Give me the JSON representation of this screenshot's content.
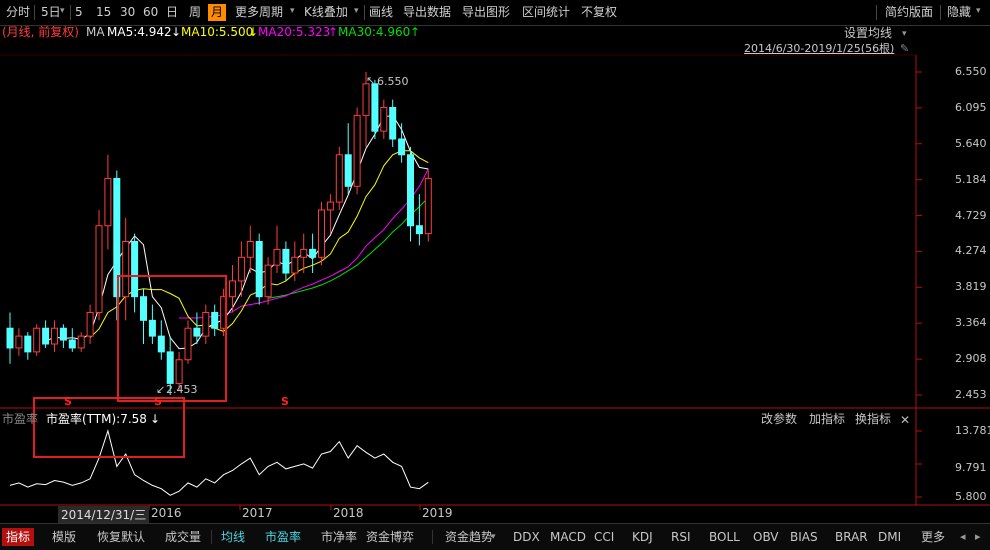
{
  "toolbar": {
    "items": [
      "分时",
      "5日",
      "5",
      "15",
      "30",
      "60",
      "日",
      "周",
      "月",
      "更多周期",
      "K线叠加",
      "画线",
      "导出数据",
      "导出图形",
      "区间统计",
      "不复权"
    ],
    "active": "月",
    "right": [
      "简约版面",
      "隐藏"
    ]
  },
  "legend": {
    "period": "(月线, 前复权)",
    "ma_label": "MA",
    "ma5": "MA5:4.942",
    "ma10": "MA10:5.500",
    "ma20": "MA20:5.323",
    "ma30": "MA30:4.960",
    "arrow_down": "↓",
    "arrow_up": "↑",
    "settings": "设置均线",
    "range": "2014/6/30-2019/1/25(56根)"
  },
  "colors": {
    "up": "#ff3c3c",
    "down": "#54ffff",
    "ma5": "#ffffff",
    "ma10": "#ffff00",
    "ma20": "#ff00ff",
    "ma30": "#00e000",
    "grid": "#3a0000",
    "axis": "#b01010",
    "highlight": "#e02020",
    "active_tab": "#b51010",
    "active_toolbar": "#ff8c00"
  },
  "price_axis": [
    "6.550",
    "6.095",
    "5.640",
    "5.184",
    "4.729",
    "4.274",
    "3.819",
    "3.364",
    "2.908",
    "2.453"
  ],
  "annotations": {
    "high": "6.550",
    "low": "2.453",
    "s_marker": "S"
  },
  "indicator": {
    "name": "市盈率",
    "title": "市盈率(TTM):7.58",
    "arrow": "↓",
    "buttons": [
      "改参数",
      "加指标",
      "换指标"
    ],
    "axis": [
      "13.781",
      "9.791",
      "5.800"
    ]
  },
  "x_axis": {
    "cursor_date": "2014/12/31/三",
    "years": [
      "2016",
      "2017",
      "2018",
      "2019"
    ]
  },
  "tabs": [
    "指标",
    "模版",
    "恢复默认",
    "成交量",
    "均线",
    "市盈率",
    "市净率",
    "资金博弈",
    "资金趋势",
    "DDX",
    "MACD",
    "CCI",
    "KDJ",
    "RSI",
    "BOLL",
    "OBV",
    "BIAS",
    "BRAR",
    "DMI",
    "更多"
  ],
  "active_tab": "指标",
  "cyan_tabs": [
    "均线",
    "市盈率"
  ],
  "chart_data": {
    "type": "candlestick",
    "price_range": [
      2.453,
      6.55
    ],
    "candles": [
      {
        "o": 3.3,
        "h": 3.5,
        "l": 2.85,
        "c": 3.05
      },
      {
        "o": 3.05,
        "h": 3.3,
        "l": 2.95,
        "c": 3.2
      },
      {
        "o": 3.2,
        "h": 3.25,
        "l": 2.9,
        "c": 3.0
      },
      {
        "o": 3.0,
        "h": 3.35,
        "l": 2.95,
        "c": 3.3
      },
      {
        "o": 3.3,
        "h": 3.4,
        "l": 3.05,
        "c": 3.1
      },
      {
        "o": 3.1,
        "h": 3.4,
        "l": 3.0,
        "c": 3.3
      },
      {
        "o": 3.3,
        "h": 3.35,
        "l": 3.05,
        "c": 3.15
      },
      {
        "o": 3.15,
        "h": 3.3,
        "l": 3.0,
        "c": 3.05
      },
      {
        "o": 3.05,
        "h": 3.25,
        "l": 3.0,
        "c": 3.2
      },
      {
        "o": 3.2,
        "h": 3.6,
        "l": 3.1,
        "c": 3.5
      },
      {
        "o": 3.5,
        "h": 4.8,
        "l": 3.4,
        "c": 4.6
      },
      {
        "o": 4.6,
        "h": 5.5,
        "l": 4.3,
        "c": 5.2
      },
      {
        "o": 5.2,
        "h": 5.3,
        "l": 3.4,
        "c": 3.7
      },
      {
        "o": 3.7,
        "h": 4.7,
        "l": 3.4,
        "c": 4.4
      },
      {
        "o": 4.4,
        "h": 4.5,
        "l": 3.5,
        "c": 3.7
      },
      {
        "o": 3.7,
        "h": 3.8,
        "l": 3.1,
        "c": 3.4
      },
      {
        "o": 3.4,
        "h": 3.6,
        "l": 3.1,
        "c": 3.2
      },
      {
        "o": 3.2,
        "h": 3.4,
        "l": 2.9,
        "c": 3.0
      },
      {
        "o": 3.0,
        "h": 3.2,
        "l": 2.453,
        "c": 2.6
      },
      {
        "o": 2.6,
        "h": 3.0,
        "l": 2.5,
        "c": 2.9
      },
      {
        "o": 2.9,
        "h": 3.4,
        "l": 2.85,
        "c": 3.3
      },
      {
        "o": 3.3,
        "h": 3.5,
        "l": 3.1,
        "c": 3.2
      },
      {
        "o": 3.2,
        "h": 3.6,
        "l": 3.1,
        "c": 3.5
      },
      {
        "o": 3.5,
        "h": 3.6,
        "l": 3.2,
        "c": 3.3
      },
      {
        "o": 3.3,
        "h": 3.8,
        "l": 3.2,
        "c": 3.7
      },
      {
        "o": 3.7,
        "h": 4.1,
        "l": 3.5,
        "c": 3.9
      },
      {
        "o": 3.9,
        "h": 4.4,
        "l": 3.7,
        "c": 4.2
      },
      {
        "o": 4.2,
        "h": 4.6,
        "l": 4.0,
        "c": 4.4
      },
      {
        "o": 4.4,
        "h": 4.5,
        "l": 3.6,
        "c": 3.7
      },
      {
        "o": 3.7,
        "h": 4.2,
        "l": 3.6,
        "c": 4.1
      },
      {
        "o": 4.1,
        "h": 4.6,
        "l": 4.0,
        "c": 4.3
      },
      {
        "o": 4.3,
        "h": 4.4,
        "l": 3.9,
        "c": 4.0
      },
      {
        "o": 4.0,
        "h": 4.4,
        "l": 3.9,
        "c": 4.2
      },
      {
        "o": 4.2,
        "h": 4.5,
        "l": 4.0,
        "c": 4.3
      },
      {
        "o": 4.3,
        "h": 4.5,
        "l": 4.0,
        "c": 4.2
      },
      {
        "o": 4.2,
        "h": 4.9,
        "l": 4.1,
        "c": 4.8
      },
      {
        "o": 4.8,
        "h": 5.0,
        "l": 4.5,
        "c": 4.9
      },
      {
        "o": 4.9,
        "h": 5.6,
        "l": 4.8,
        "c": 5.5
      },
      {
        "o": 5.5,
        "h": 5.9,
        "l": 5.0,
        "c": 5.1
      },
      {
        "o": 5.1,
        "h": 6.1,
        "l": 5.0,
        "c": 6.0
      },
      {
        "o": 6.0,
        "h": 6.55,
        "l": 5.6,
        "c": 6.4
      },
      {
        "o": 6.4,
        "h": 6.45,
        "l": 5.7,
        "c": 5.8
      },
      {
        "o": 5.8,
        "h": 6.2,
        "l": 5.7,
        "c": 6.1
      },
      {
        "o": 6.1,
        "h": 6.2,
        "l": 5.6,
        "c": 5.7
      },
      {
        "o": 5.7,
        "h": 5.9,
        "l": 5.4,
        "c": 5.5
      },
      {
        "o": 5.5,
        "h": 5.6,
        "l": 4.4,
        "c": 4.6
      },
      {
        "o": 4.6,
        "h": 5.0,
        "l": 4.35,
        "c": 4.5
      },
      {
        "o": 4.5,
        "h": 5.3,
        "l": 4.4,
        "c": 5.2
      }
    ],
    "ma5": [
      null,
      null,
      null,
      null,
      3.13,
      3.19,
      3.17,
      3.18,
      3.16,
      3.23,
      3.56,
      3.98,
      4.15,
      4.32,
      4.47,
      4.36,
      3.7,
      3.56,
      3.18,
      3.04,
      3.05,
      3.12,
      3.3,
      3.36,
      3.41,
      3.56,
      3.76,
      4.06,
      4.0,
      4.03,
      4.15,
      4.1,
      4.16,
      4.26,
      4.18,
      4.34,
      4.48,
      4.74,
      4.99,
      5.28,
      5.58,
      5.76,
      5.98,
      6.0,
      5.82,
      5.54,
      5.34,
      5.32
    ],
    "ma10": [
      null,
      null,
      null,
      null,
      null,
      null,
      null,
      null,
      null,
      3.18,
      3.29,
      3.5,
      3.57,
      3.71,
      3.78,
      3.8,
      3.79,
      3.79,
      3.74,
      3.68,
      3.45,
      3.33,
      3.34,
      3.3,
      3.26,
      3.36,
      3.52,
      3.72,
      3.77,
      3.87,
      3.85,
      3.9,
      4.0,
      4.06,
      4.1,
      4.15,
      4.24,
      4.44,
      4.52,
      4.72,
      4.97,
      5.12,
      5.36,
      5.5,
      5.55,
      5.55,
      5.46,
      5.4
    ],
    "ma20": [
      null,
      null,
      null,
      null,
      null,
      null,
      null,
      null,
      null,
      null,
      null,
      null,
      null,
      null,
      null,
      null,
      null,
      null,
      null,
      3.43,
      3.43,
      3.43,
      3.44,
      3.45,
      3.47,
      3.51,
      3.58,
      3.6,
      3.62,
      3.65,
      3.68,
      3.71,
      3.77,
      3.82,
      3.86,
      3.91,
      3.96,
      4.02,
      4.08,
      4.19,
      4.34,
      4.45,
      4.55,
      4.69,
      4.81,
      4.94,
      5.1,
      5.32
    ],
    "ma30": [
      null,
      null,
      null,
      null,
      null,
      null,
      null,
      null,
      null,
      null,
      null,
      null,
      null,
      null,
      null,
      null,
      null,
      null,
      null,
      null,
      null,
      null,
      null,
      null,
      null,
      null,
      null,
      null,
      null,
      3.68,
      3.7,
      3.72,
      3.75,
      3.78,
      3.81,
      3.85,
      3.9,
      3.96,
      4.03,
      4.1,
      4.2,
      4.3,
      4.4,
      4.52,
      4.62,
      4.74,
      4.84,
      4.96
    ],
    "pe_ttm": [
      7.2,
      7.5,
      7.0,
      7.4,
      7.3,
      7.8,
      7.6,
      7.2,
      7.5,
      8.0,
      10.5,
      13.8,
      9.5,
      11.0,
      8.5,
      7.8,
      7.2,
      6.8,
      6.0,
      6.5,
      7.5,
      7.0,
      8.0,
      7.5,
      8.5,
      9.0,
      9.8,
      10.5,
      8.5,
      9.5,
      10.0,
      9.2,
      9.5,
      9.8,
      9.3,
      11.0,
      11.3,
      12.5,
      10.5,
      12.0,
      11.2,
      10.5,
      11.0,
      10.0,
      9.5,
      7.0,
      6.8,
      7.58
    ]
  }
}
